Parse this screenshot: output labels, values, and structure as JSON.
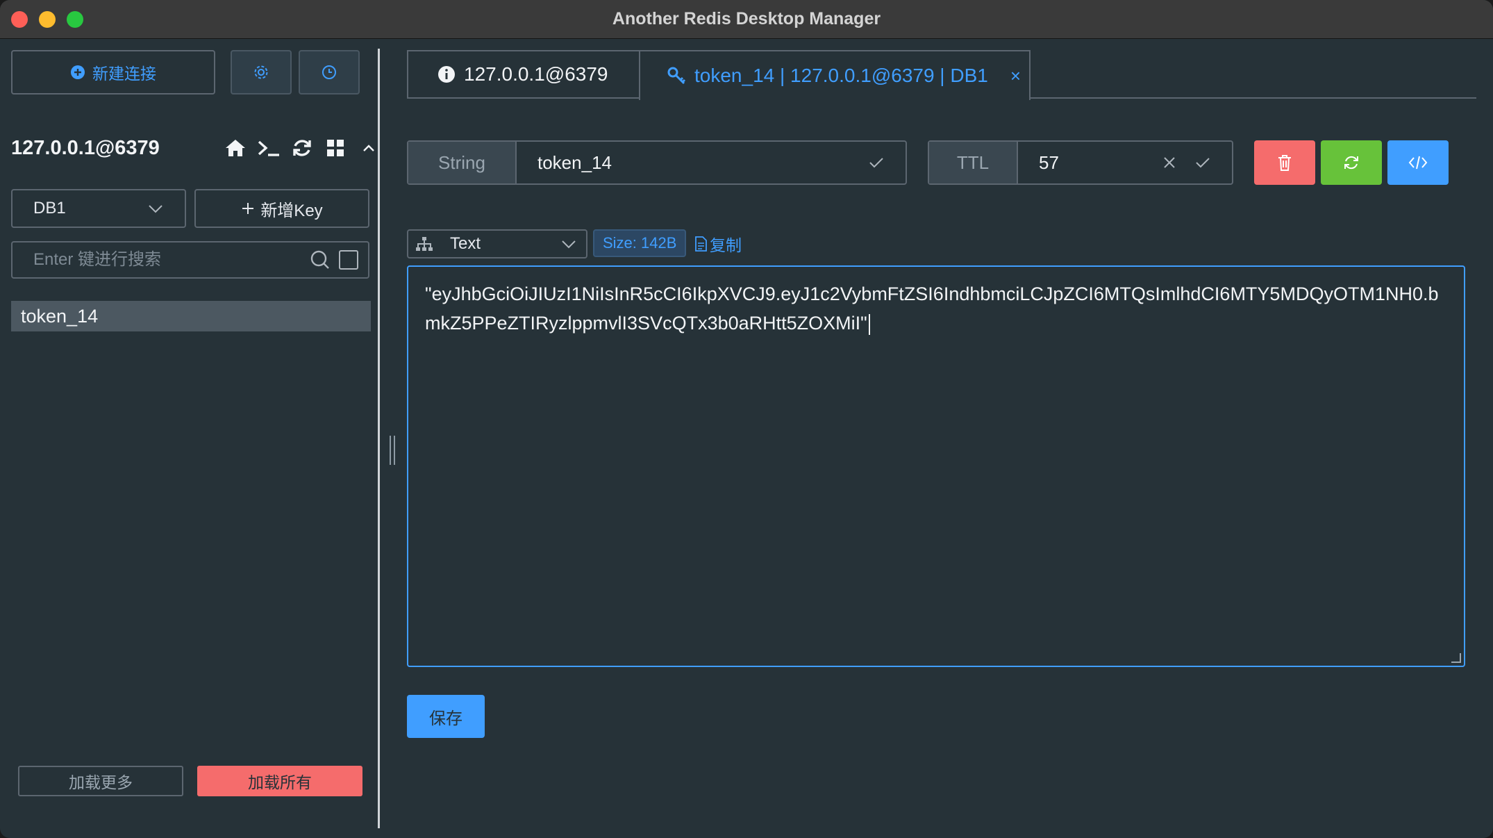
{
  "window": {
    "title": "Another Redis Desktop Manager"
  },
  "sidebar": {
    "new_connection_label": "新建连接",
    "connection_name": "127.0.0.1@6379",
    "db_select_value": "DB1",
    "add_key_label": "新增Key",
    "search_placeholder": "Enter 键进行搜索",
    "keys": [
      "token_14"
    ],
    "load_more_label": "加载更多",
    "load_all_label": "加载所有"
  },
  "tabs": [
    {
      "label": "127.0.0.1@6379",
      "icon": "info-icon"
    },
    {
      "label": "token_14 | 127.0.0.1@6379 | DB1",
      "icon": "key-icon"
    }
  ],
  "key_detail": {
    "type_label": "String",
    "key_name": "token_14",
    "ttl_label": "TTL",
    "ttl_value": "57",
    "format_label": "Text",
    "size_label": "Size: 142B",
    "copy_label": "复制",
    "value": "\"eyJhbGciOiJIUzI1NiIsInR5cCI6IkpXVCJ9.eyJ1c2VybmFtZSI6IndhbmciLCJpZCI6MTQsImlhdCI6MTY5MDQyOTM1NH0.bmkZ5PPeZTIRyzlppmvlI3SVcQTx3b0aRHtt5ZOXMiI\"",
    "save_label": "保存"
  },
  "colors": {
    "accent": "#409eff",
    "danger": "#f56c6c",
    "success": "#67c23a",
    "background": "#263238"
  }
}
